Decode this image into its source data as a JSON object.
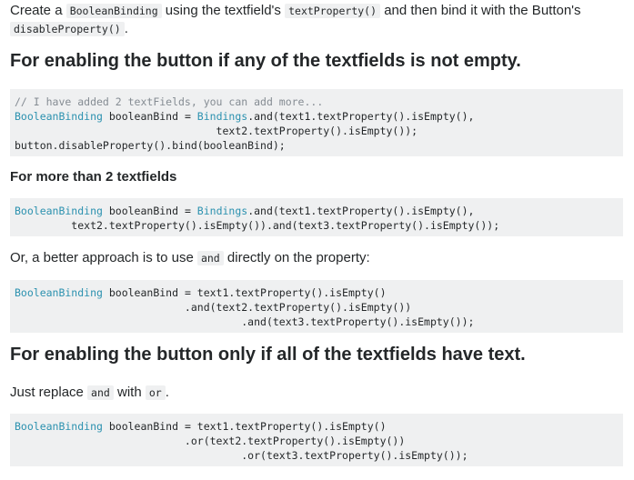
{
  "intro": {
    "t1": "Create a ",
    "c1": "BooleanBinding",
    "t2": " using the textfield's ",
    "c2": "textProperty()",
    "t3": " and then bind it with the Button's",
    "c3": "disableProperty()",
    "t4": "."
  },
  "heading1": "For enabling the button if any of the textfields is not empty.",
  "code1": {
    "l1_comment": "// I have added 2 textFields, you can add more...",
    "l2_type": "BooleanBinding",
    "l2_a": " booleanBind = ",
    "l2_cls": "Bindings",
    "l2_b": ".and(text1.textProperty().isEmpty(),",
    "l3": "                                text2.textProperty().isEmpty());",
    "l4": "button.disableProperty().bind(booleanBind);"
  },
  "heading2": "For more than 2 textfields",
  "code2": {
    "l1_type": "BooleanBinding",
    "l1_a": " booleanBind = ",
    "l1_cls": "Bindings",
    "l1_b": ".and(text1.textProperty().isEmpty(),",
    "l2": "         text2.textProperty().isEmpty()).and(text3.textProperty().isEmpty());"
  },
  "para2": {
    "t1": "Or, a better approach is to use ",
    "c1": "and",
    "t2": " directly on the property:"
  },
  "code3": {
    "l1_type": "BooleanBinding",
    "l1_a": " booleanBind = text1.textProperty().isEmpty()",
    "l2": "                           .and(text2.textProperty().isEmpty())",
    "l3": "                                    .and(text3.textProperty().isEmpty());"
  },
  "heading3": "For enabling the button only if all of the textfields have text.",
  "para3": {
    "t1": "Just replace ",
    "c1": "and",
    "t2": " with ",
    "c2": "or",
    "t3": "."
  },
  "code4": {
    "l1_type": "BooleanBinding",
    "l1_a": " booleanBind = text1.textProperty().isEmpty()",
    "l2": "                           .or(text2.textProperty().isEmpty())",
    "l3": "                                    .or(text3.textProperty().isEmpty());"
  },
  "colors": {
    "type_keyword": "#2b91af",
    "comment": "#858c93",
    "code_background": "#eff0f1",
    "text": "#242729"
  }
}
